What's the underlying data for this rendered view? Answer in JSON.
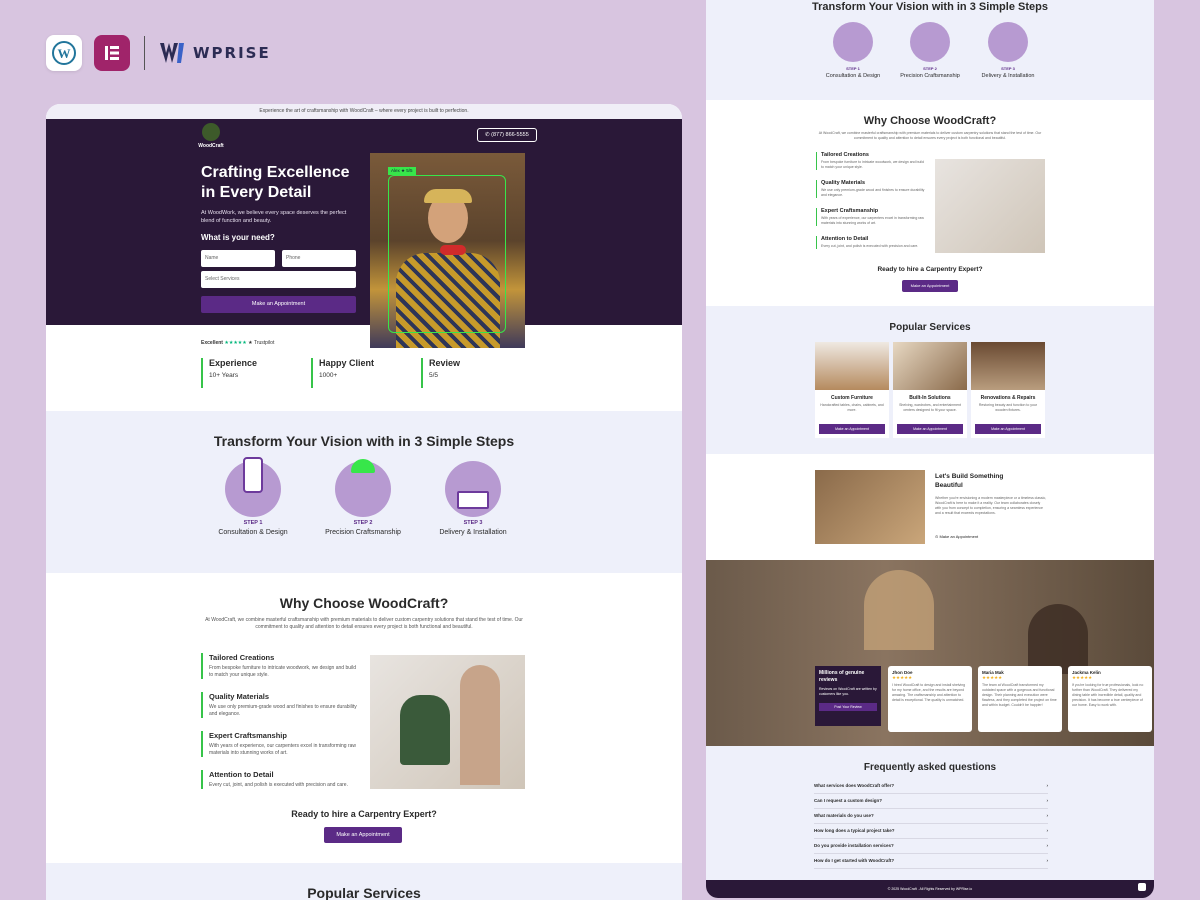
{
  "brand": {
    "name": "WPRISE",
    "wp_icon": "wordpress-icon",
    "el_icon": "elementor-icon"
  },
  "left": {
    "topnote": "Experience the art of craftsmanship with WoodCraft – where every project is built to perfection.",
    "logo_text": "WoodCraft",
    "phone": "(877) 866-5555",
    "hero_title_1": "Crafting Excellence",
    "hero_title_2": "in Every Detail",
    "hero_sub": "At WoodWork, we believe every space deserves the perfect blend of function and beauty.",
    "need": "What is your need?",
    "name_ph": "Name",
    "phone_ph": "Phone",
    "service_ph": "Select Services",
    "appointment": "Make an Appointment",
    "alex_tag": "Alex ★ 5/5",
    "trust_excellent": "Excellent",
    "trust_stars": "★★★★★",
    "trust_brand": "★ Trustpilot",
    "stats": [
      {
        "title": "Experience",
        "value": "10+ Years"
      },
      {
        "title": "Happy Client",
        "value": "1000+"
      },
      {
        "title": "Review",
        "value": "5/5"
      }
    ],
    "steps_title": "Transform Your Vision with in 3 Simple Steps",
    "steps": [
      {
        "label": "STEP 1",
        "name": "Consultation & Design"
      },
      {
        "label": "STEP 2",
        "name": "Precision Craftsmanship"
      },
      {
        "label": "STEP 3",
        "name": "Delivery & Installation"
      }
    ],
    "why_title": "Why Choose WoodCraft?",
    "why_intro": "At WoodCraft, we combine masterful craftsmanship with premium materials to deliver custom carpentry solutions that stand the test of time. Our commitment to quality and attention to detail ensures every project is both functional and beautiful.",
    "features": [
      {
        "title": "Tailored Creations",
        "desc": "From bespoke furniture to intricate woodwork, we design and build to match your unique style."
      },
      {
        "title": "Quality Materials",
        "desc": "We use only premium-grade wood and finishes to ensure durability and elegance."
      },
      {
        "title": "Expert Craftsmanship",
        "desc": "With years of experience, our carpenters excel in transforming raw materials into stunning works of art."
      },
      {
        "title": "Attention to Detail",
        "desc": "Every cut, joint, and polish is executed with precision and care."
      }
    ],
    "ready": "Ready to hire a Carpentry Expert?",
    "popular": "Popular Services"
  },
  "right": {
    "steps_title": "Transform Your Vision with in 3 Simple Steps",
    "steps": [
      {
        "label": "STEP 1",
        "name": "Consultation & Design"
      },
      {
        "label": "STEP 2",
        "name": "Precision Craftsmanship"
      },
      {
        "label": "STEP 3",
        "name": "Delivery & Installation"
      }
    ],
    "why_title": "Why Choose WoodCraft?",
    "why_intro": "At WoodCraft, we combine masterful craftsmanship with premium materials to deliver custom carpentry solutions that stand the test of time. Our commitment to quality and attention to detail ensures every project is both functional and beautiful.",
    "features": [
      {
        "title": "Tailored Creations",
        "desc": "From bespoke furniture to intricate woodwork, we design and build to match your unique style."
      },
      {
        "title": "Quality Materials",
        "desc": "We use only premium-grade wood and finishes to ensure durability and elegance."
      },
      {
        "title": "Expert Craftsmanship",
        "desc": "With years of experience, our carpenters excel in transforming raw materials into stunning works of art."
      },
      {
        "title": "Attention to Detail",
        "desc": "Every cut, joint, and polish is executed with precision and care."
      }
    ],
    "ready": "Ready to hire a Carpentry Expert?",
    "appointment": "Make an Appointment",
    "popular": "Popular Services",
    "services": [
      {
        "title": "Custom Furniture",
        "desc": "Handcrafted tables, chairs, cabinets, and more."
      },
      {
        "title": "Built-In Solutions",
        "desc": "Shelving, wardrobes, and entertainment centers designed to fit your space."
      },
      {
        "title": "Renovations & Repairs",
        "desc": "Restoring beauty and function to your wooden fixtures."
      }
    ],
    "build_title": "Let's Build Something Beautiful",
    "build_desc": "Whether you're envisioning a modern masterpiece or a timeless classic, WoodCraft is here to make it a reality. Our team collaborates closely with you from concept to completion, ensuring a seamless experience and a result that exceeds expectations.",
    "build_link": "Make an Appointment",
    "millions": "Millions of genuine reviews",
    "millions_sub": "Reviews on WoodCraft are written by customers like you.",
    "post_review": "Post Your Review",
    "testimonials": [
      {
        "name": "Jhon Doe",
        "stars": "★★★★★",
        "quote": "I hired WoodCraft to design and install shelving for my home office, and the results are beyond amazing. The craftsmanship and attention to detail is exceptional. The quality is unmatched."
      },
      {
        "name": "Maria Mak",
        "stars": "★★★★★",
        "quote": "The team at WoodCraft transformed my outdated space with a gorgeous and functional design. Their planning and execution were flawless, and they completed the project on time and within budget. Couldn't be happier!"
      },
      {
        "name": "Jackma Kelin",
        "stars": "★★★★★",
        "quote": "If you're looking for true professionals, look no further than WoodCraft. They delivered my dining table with incredible detail, quality and precision. It has become a true centerpiece of our home. Easy to work with."
      }
    ],
    "faq_title": "Frequently asked questions",
    "faqs": [
      "What services does WoodCraft offer?",
      "Can I request a custom design?",
      "What materials do you use?",
      "How long does a typical project take?",
      "Do you provide installation services?",
      "How do I get started with WoodCraft?"
    ],
    "footer": "© 2025 WoodCraft . All Rights Reserved by WPRise.io"
  }
}
